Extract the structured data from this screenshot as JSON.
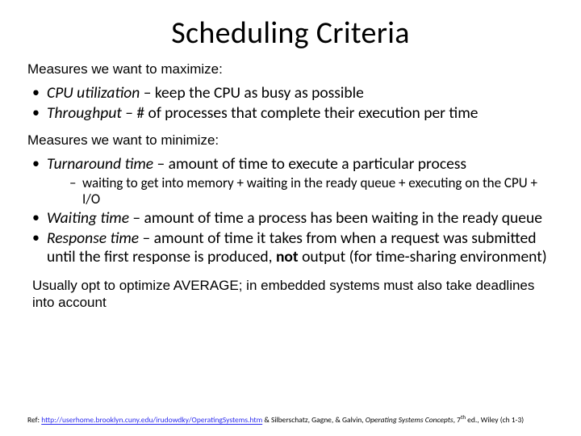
{
  "title": "Scheduling Criteria",
  "sections": {
    "maximize": {
      "label": "Measures we want to maximize:",
      "items": [
        {
          "term": "CPU utilization",
          "desc": " – keep the CPU as busy as possible"
        },
        {
          "term": "Throughput",
          "desc": " – # of processes that complete their execution per time"
        }
      ]
    },
    "minimize": {
      "label": "Measures we want to minimize:",
      "items": [
        {
          "term": "Turnaround time",
          "desc": " – amount of time to execute a particular process",
          "sub": "waiting to get into memory + waiting in the ready queue + executing on the CPU + I/O"
        },
        {
          "term": "Waiting time",
          "desc": " – amount of time a process has been waiting in the ready queue"
        },
        {
          "term": "Response time",
          "desc_pre": " – amount of time it takes from when a request was submitted until the first response is produced, ",
          "bold": "not",
          "desc_post": " output  (for time-sharing environment)"
        }
      ]
    }
  },
  "footer": "Usually opt to optimize AVERAGE; in embedded systems must also take deadlines into account",
  "ref": {
    "prefix": "Ref: ",
    "url": "http://userhome.brooklyn.cuny.edu/irudowdky/OperatingSystems.htm",
    "mid": "  & Silberschatz, Gagne, & Galvin, ",
    "book": "Operating Systems Concepts",
    "suffix": ", 7",
    "sup": "th",
    "tail": " ed., Wiley (ch 1-3)"
  }
}
